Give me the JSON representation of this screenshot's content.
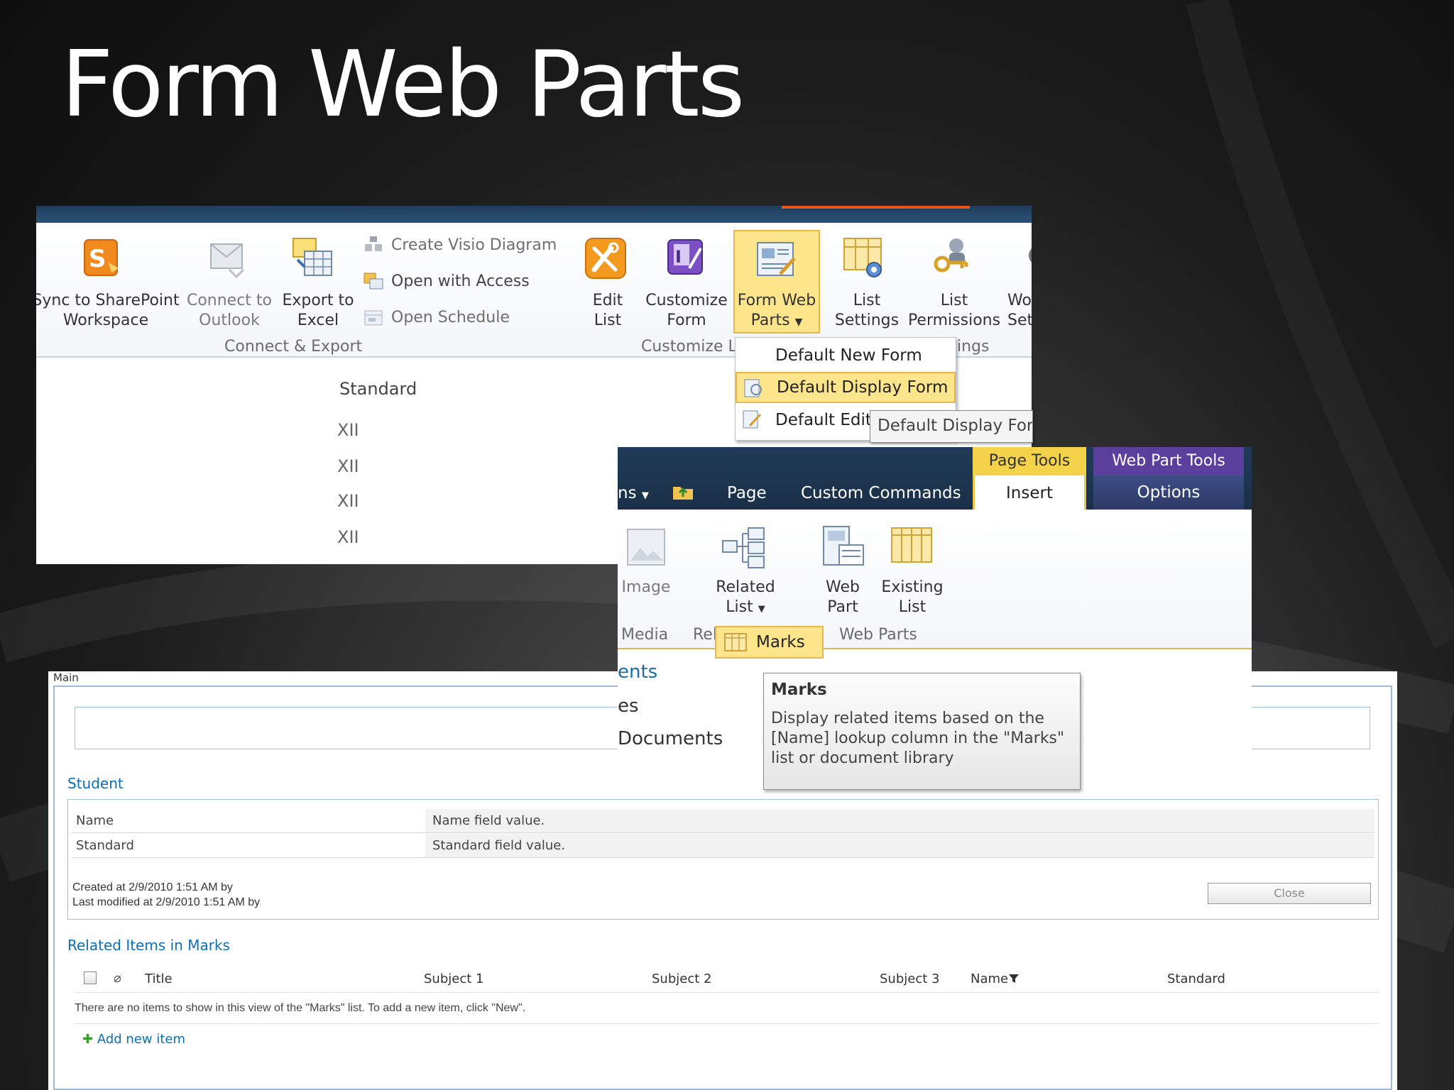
{
  "slide": {
    "title": "Form Web Parts"
  },
  "list_ribbon": {
    "buttons": {
      "sync": [
        "Sync to SharePoint",
        "Workspace"
      ],
      "connect_outlook": [
        "Connect to",
        "Outlook"
      ],
      "export_excel": [
        "Export to",
        "Excel"
      ],
      "edit_list": [
        "Edit",
        "List"
      ],
      "customize_form": [
        "Customize",
        "Form"
      ],
      "form_web_parts": [
        "Form Web",
        "Parts"
      ],
      "list_settings": [
        "List",
        "Settings"
      ],
      "list_permissions": [
        "List",
        "Permissions"
      ],
      "workflow_settings": [
        "Wo",
        "Set"
      ]
    },
    "small_items": [
      "Create Visio Diagram",
      "Open with Access",
      "Open Schedule"
    ],
    "groups": {
      "connect_export": "Connect & Export",
      "customize": "Customize L",
      "settings": "ings"
    },
    "column_header": "Standard",
    "rows": [
      "XII",
      "XII",
      "XII",
      "XII"
    ],
    "dropdown": [
      "Default New Form",
      "Default Display Form",
      "Default Edit"
    ],
    "tooltip": "Default Display For"
  },
  "page_ribbon": {
    "tabs": {
      "actions": "ns",
      "page": "Page",
      "custom_commands": "Custom Commands"
    },
    "contextual": {
      "page_tools": {
        "group": "Page Tools",
        "tab": "Insert"
      },
      "web_part_tools": {
        "group": "Web Part Tools",
        "tab": "Options"
      }
    },
    "buttons": {
      "image": "Image",
      "related_list": [
        "Related",
        "List"
      ],
      "web_part": [
        "Web",
        "Part"
      ],
      "existing_list": [
        "Existing",
        "List"
      ]
    },
    "groups": {
      "media": "Media",
      "related": "Rel",
      "web_parts": "Web Parts"
    },
    "body_text": [
      "ents",
      "es",
      "Documents"
    ],
    "marks_item": "Marks",
    "tooltip": {
      "title": "Marks",
      "body": "Display related items based on the [Name] lookup column in the \"Marks\" list or document library"
    }
  },
  "form": {
    "zone_label": "Main",
    "student_title": "Student",
    "fields": [
      {
        "label": "Name",
        "value": "Name field value."
      },
      {
        "label": "Standard",
        "value": "Standard field value."
      }
    ],
    "created": "Created at 2/9/2010 1:51 AM by",
    "modified": "Last modified at 2/9/2010 1:51 AM by",
    "close_label": "Close",
    "related_title": "Related Items in Marks",
    "columns": [
      "Title",
      "Subject 1",
      "Subject 2",
      "Subject 3",
      "Name",
      "Standard"
    ],
    "empty_message": "There are no items to show in this view of the \"Marks\" list. To add a new item, click \"New\".",
    "add_new": "Add new item"
  }
}
